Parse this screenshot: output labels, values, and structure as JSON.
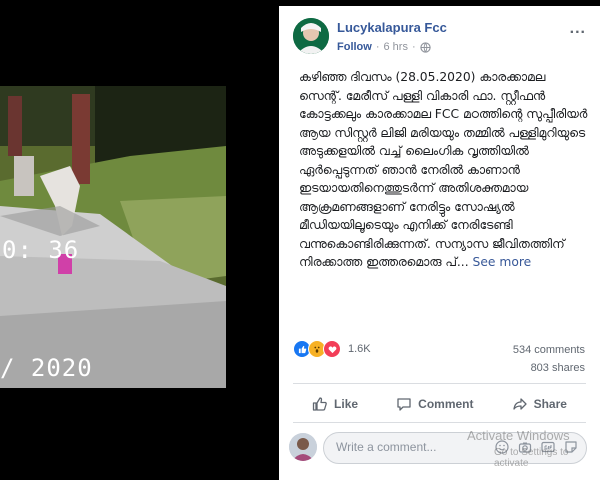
{
  "video": {
    "timestamp_overlay": "0: 36",
    "date_overlay": "/ 2020"
  },
  "post": {
    "page_name": "Lucykalapura Fcc",
    "follow_label": "Follow",
    "separator": "·",
    "time_ago": "6 hrs",
    "privacy_icon": "globe-icon",
    "more_options_label": "...",
    "text": "കഴിഞ്ഞ ദിവസം (28.05.2020) കാരക്കാമല സെന്റ്. മേരീസ് പള്ളി വികാരി ഫാ. സ്റ്റീഫൻ കോട്ടക്കലും കാരക്കാമല FCC മഠത്തിന്റെ സുപ്പീരിയർ ആയ സിസ്റ്റർ ലിജി മരിയയും തമ്മിൽ പള്ളിമുറിയുടെ അടുക്കളയിൽ വച്ച് ലൈംഗിക വൃത്തിയിൽ ഏർപ്പെടുന്നത് ഞാൻ നേരിൽ കാണാൻ ഇടയായതിനെത്തുടർന്ന് അതിശക്തമായ ആക്രമണങ്ങളാണ് നേരിട്ടും സോഷ്യൽ മീഡിയയിലൂടെയും എനിക്ക് നേരിടേണ്ടി വന്നുകൊണ്ടിരിക്കുന്നത്. സന്യാസ ജീവിതത്തിന് നിരക്കാത്ത ഇത്തരമൊരു പ്...",
    "see_more_label": "See more"
  },
  "engagement": {
    "reaction_count": "1.6K",
    "comments": "534 comments",
    "shares": "803 shares"
  },
  "actions": {
    "like": "Like",
    "comment": "Comment",
    "share": "Share"
  },
  "composer": {
    "placeholder": "Write a comment..."
  },
  "watermark": {
    "title": "Activate Windows",
    "subtitle": "Go to Settings to activate"
  },
  "colors": {
    "link_blue": "#365899",
    "like_blue": "#1877f2",
    "wow_yellow": "#f7b125",
    "love_red": "#f33e58"
  }
}
